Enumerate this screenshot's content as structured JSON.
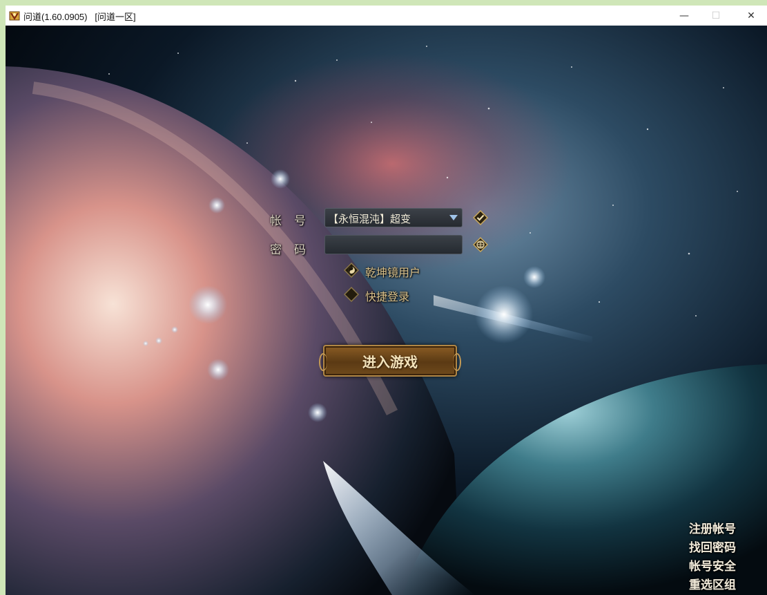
{
  "window": {
    "title": "问道(1.60.0905)   [问道一区]",
    "minimize_glyph": "—",
    "maximize_glyph": "☐",
    "close_glyph": "✕"
  },
  "login": {
    "account_label": "帐号",
    "password_label": "密码",
    "account_value": "【永恒混沌】超变",
    "password_value": "",
    "option_qiankun": "乾坤镜用户",
    "option_quick": "快捷登录",
    "enter_button": "进入游戏"
  },
  "side_links": [
    "注册帐号",
    "找回密码",
    "帐号安全",
    "重选区组"
  ],
  "icons": {
    "app": "game-app-icon",
    "confirm": "checkmark-icon",
    "keyboard": "soft-keyboard-icon",
    "qiankun": "yin-yang-icon",
    "dropdown": "chevron-down-icon"
  },
  "colors": {
    "label_text": "#d8d0bf",
    "option_text": "#d9c08a",
    "button_brown": "#5b3a14",
    "button_border": "#b08644",
    "link_text": "#f1ead9"
  }
}
